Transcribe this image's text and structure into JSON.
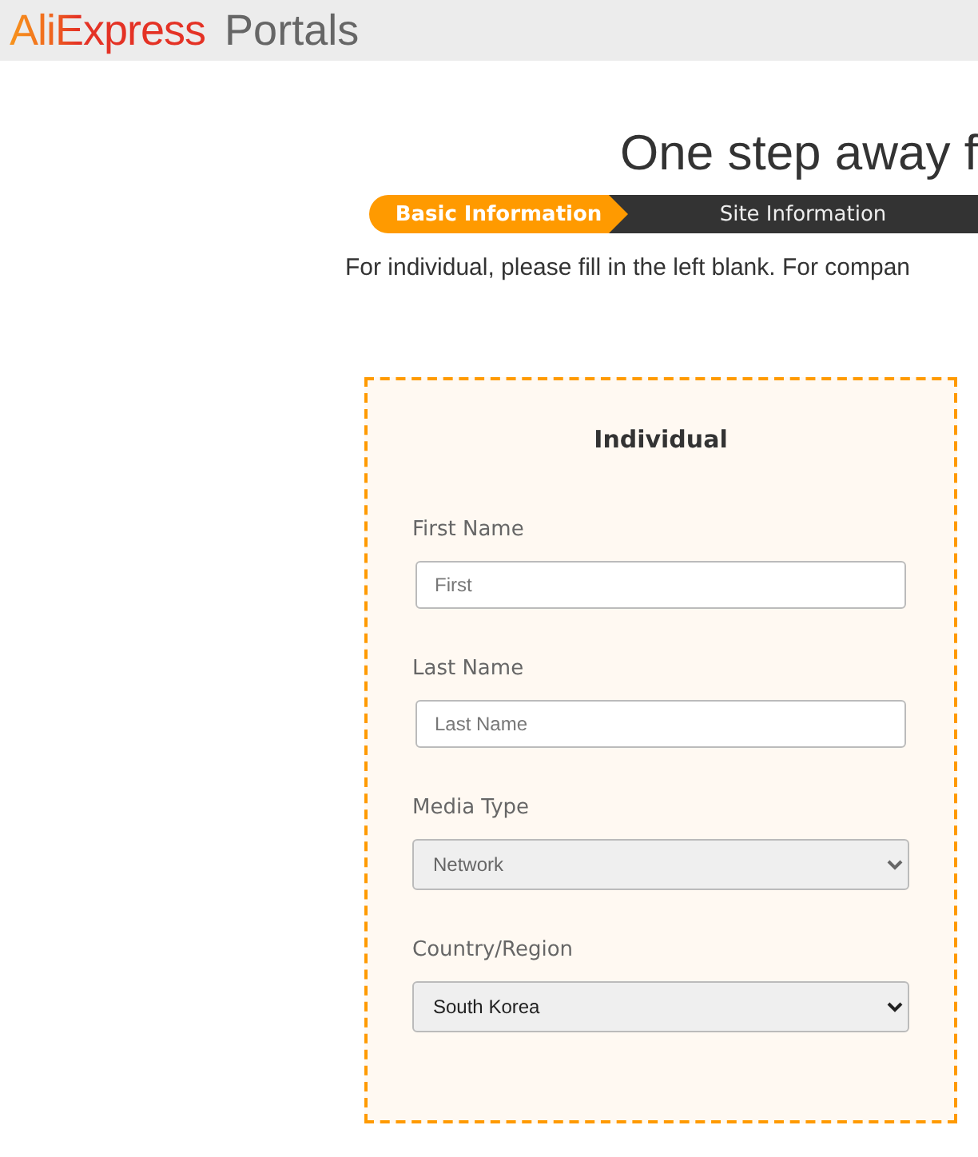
{
  "header": {
    "logo": "AliExpress",
    "product": "Portals"
  },
  "title": "One step away f",
  "steps": [
    {
      "label": "Basic Information",
      "selected": true
    },
    {
      "label": "Site Information",
      "selected": false
    }
  ],
  "instruction": "For individual, please fill in the left blank. For compan",
  "individual": {
    "heading": "Individual",
    "fields": [
      {
        "kind": "text",
        "label": "First Name",
        "placeholder": "First"
      },
      {
        "kind": "text",
        "label": "Last Name",
        "placeholder": "Last Name"
      },
      {
        "kind": "select",
        "label": "Media Type",
        "value": "Network",
        "muted": true
      },
      {
        "kind": "select",
        "label": "Country/Region",
        "value": "South Korea",
        "muted": false
      }
    ]
  }
}
